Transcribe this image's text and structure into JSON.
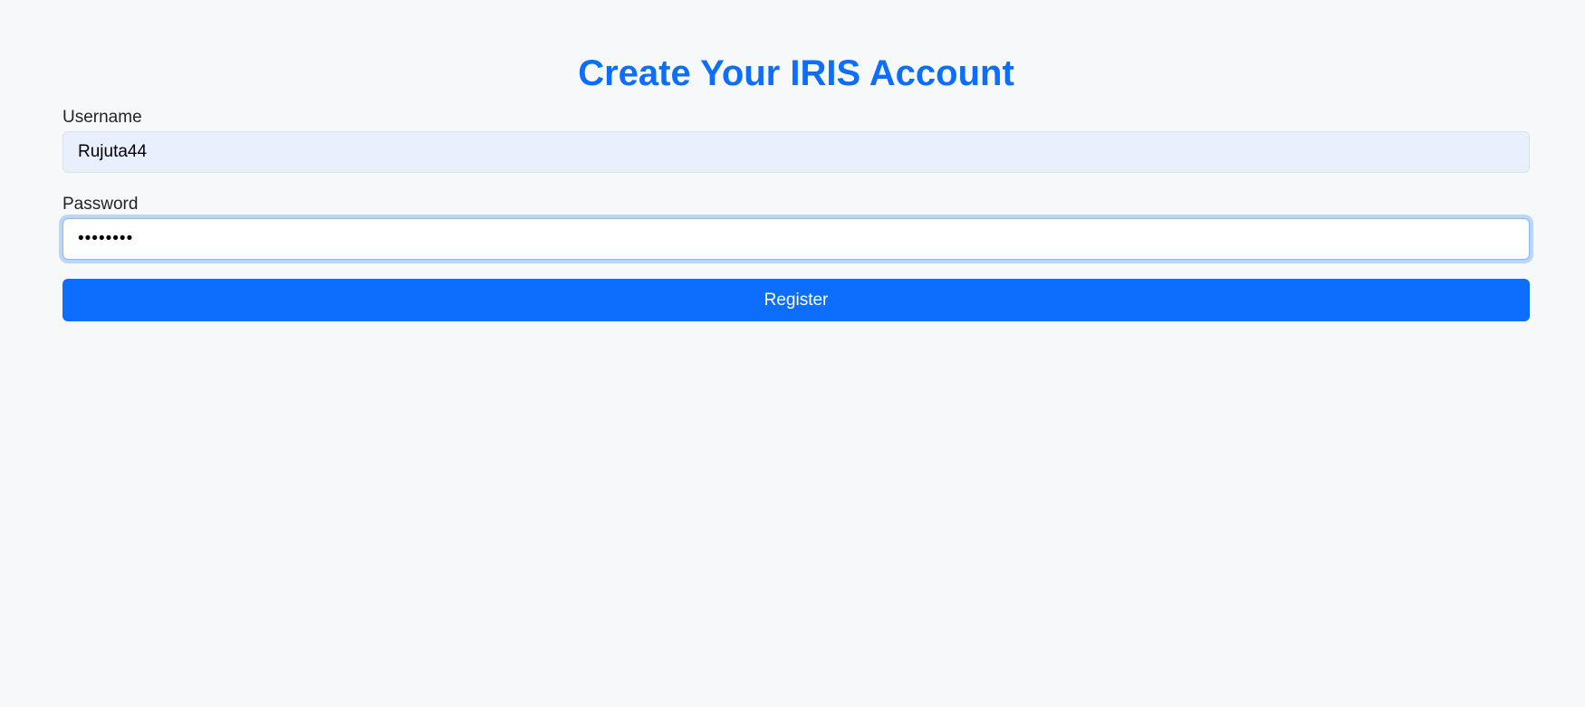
{
  "page": {
    "title": "Create Your IRIS Account"
  },
  "form": {
    "username": {
      "label": "Username",
      "value": "Rujuta44"
    },
    "password": {
      "label": "Password",
      "value": "••••••••"
    },
    "register_label": "Register"
  },
  "colors": {
    "accent": "#0d6efd",
    "background": "#f7f8fa",
    "autofill_bg": "#e8f0fe"
  }
}
